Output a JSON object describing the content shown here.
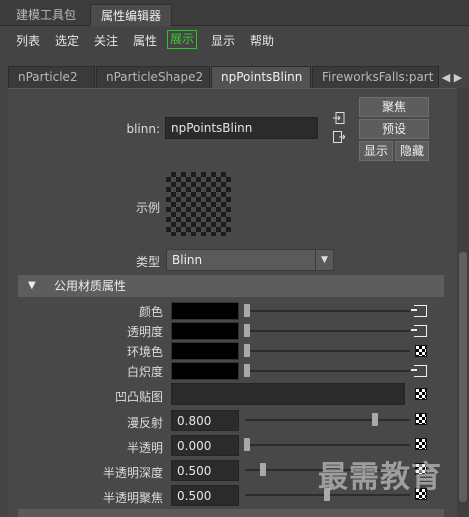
{
  "top_tabs": [
    "建模工具包",
    "属性编辑器"
  ],
  "menu": [
    "列表",
    "选定",
    "关注",
    "属性",
    "展示",
    "显示",
    "帮助"
  ],
  "node_tabs": [
    "nParticle2",
    "nParticleShape2",
    "npPointsBlinn",
    "FireworksFalls:part"
  ],
  "blinn": {
    "label": "blinn:",
    "value": "npPointsBlinn"
  },
  "buttons": {
    "focus": "聚焦",
    "presets": "预设",
    "show": "显示",
    "hide": "隐藏"
  },
  "sample_label": "示例",
  "type": {
    "label": "类型",
    "value": "Blinn"
  },
  "section": "公用材质属性",
  "color_attrs": [
    {
      "label": "颜色"
    },
    {
      "label": "透明度"
    },
    {
      "label": "环境色"
    },
    {
      "label": "白炽度"
    }
  ],
  "bump_label": "凹凸贴图",
  "numeric_attrs": [
    {
      "label": "漫反射",
      "value": "0.800",
      "fraction": 0.8
    },
    {
      "label": "半透明",
      "value": "0.000",
      "fraction": 0.0
    },
    {
      "label": "半透明深度",
      "value": "0.500",
      "fraction": 0.1
    },
    {
      "label": "半透明聚焦",
      "value": "0.500",
      "fraction": 0.5
    }
  ],
  "watermark": "最需教育"
}
